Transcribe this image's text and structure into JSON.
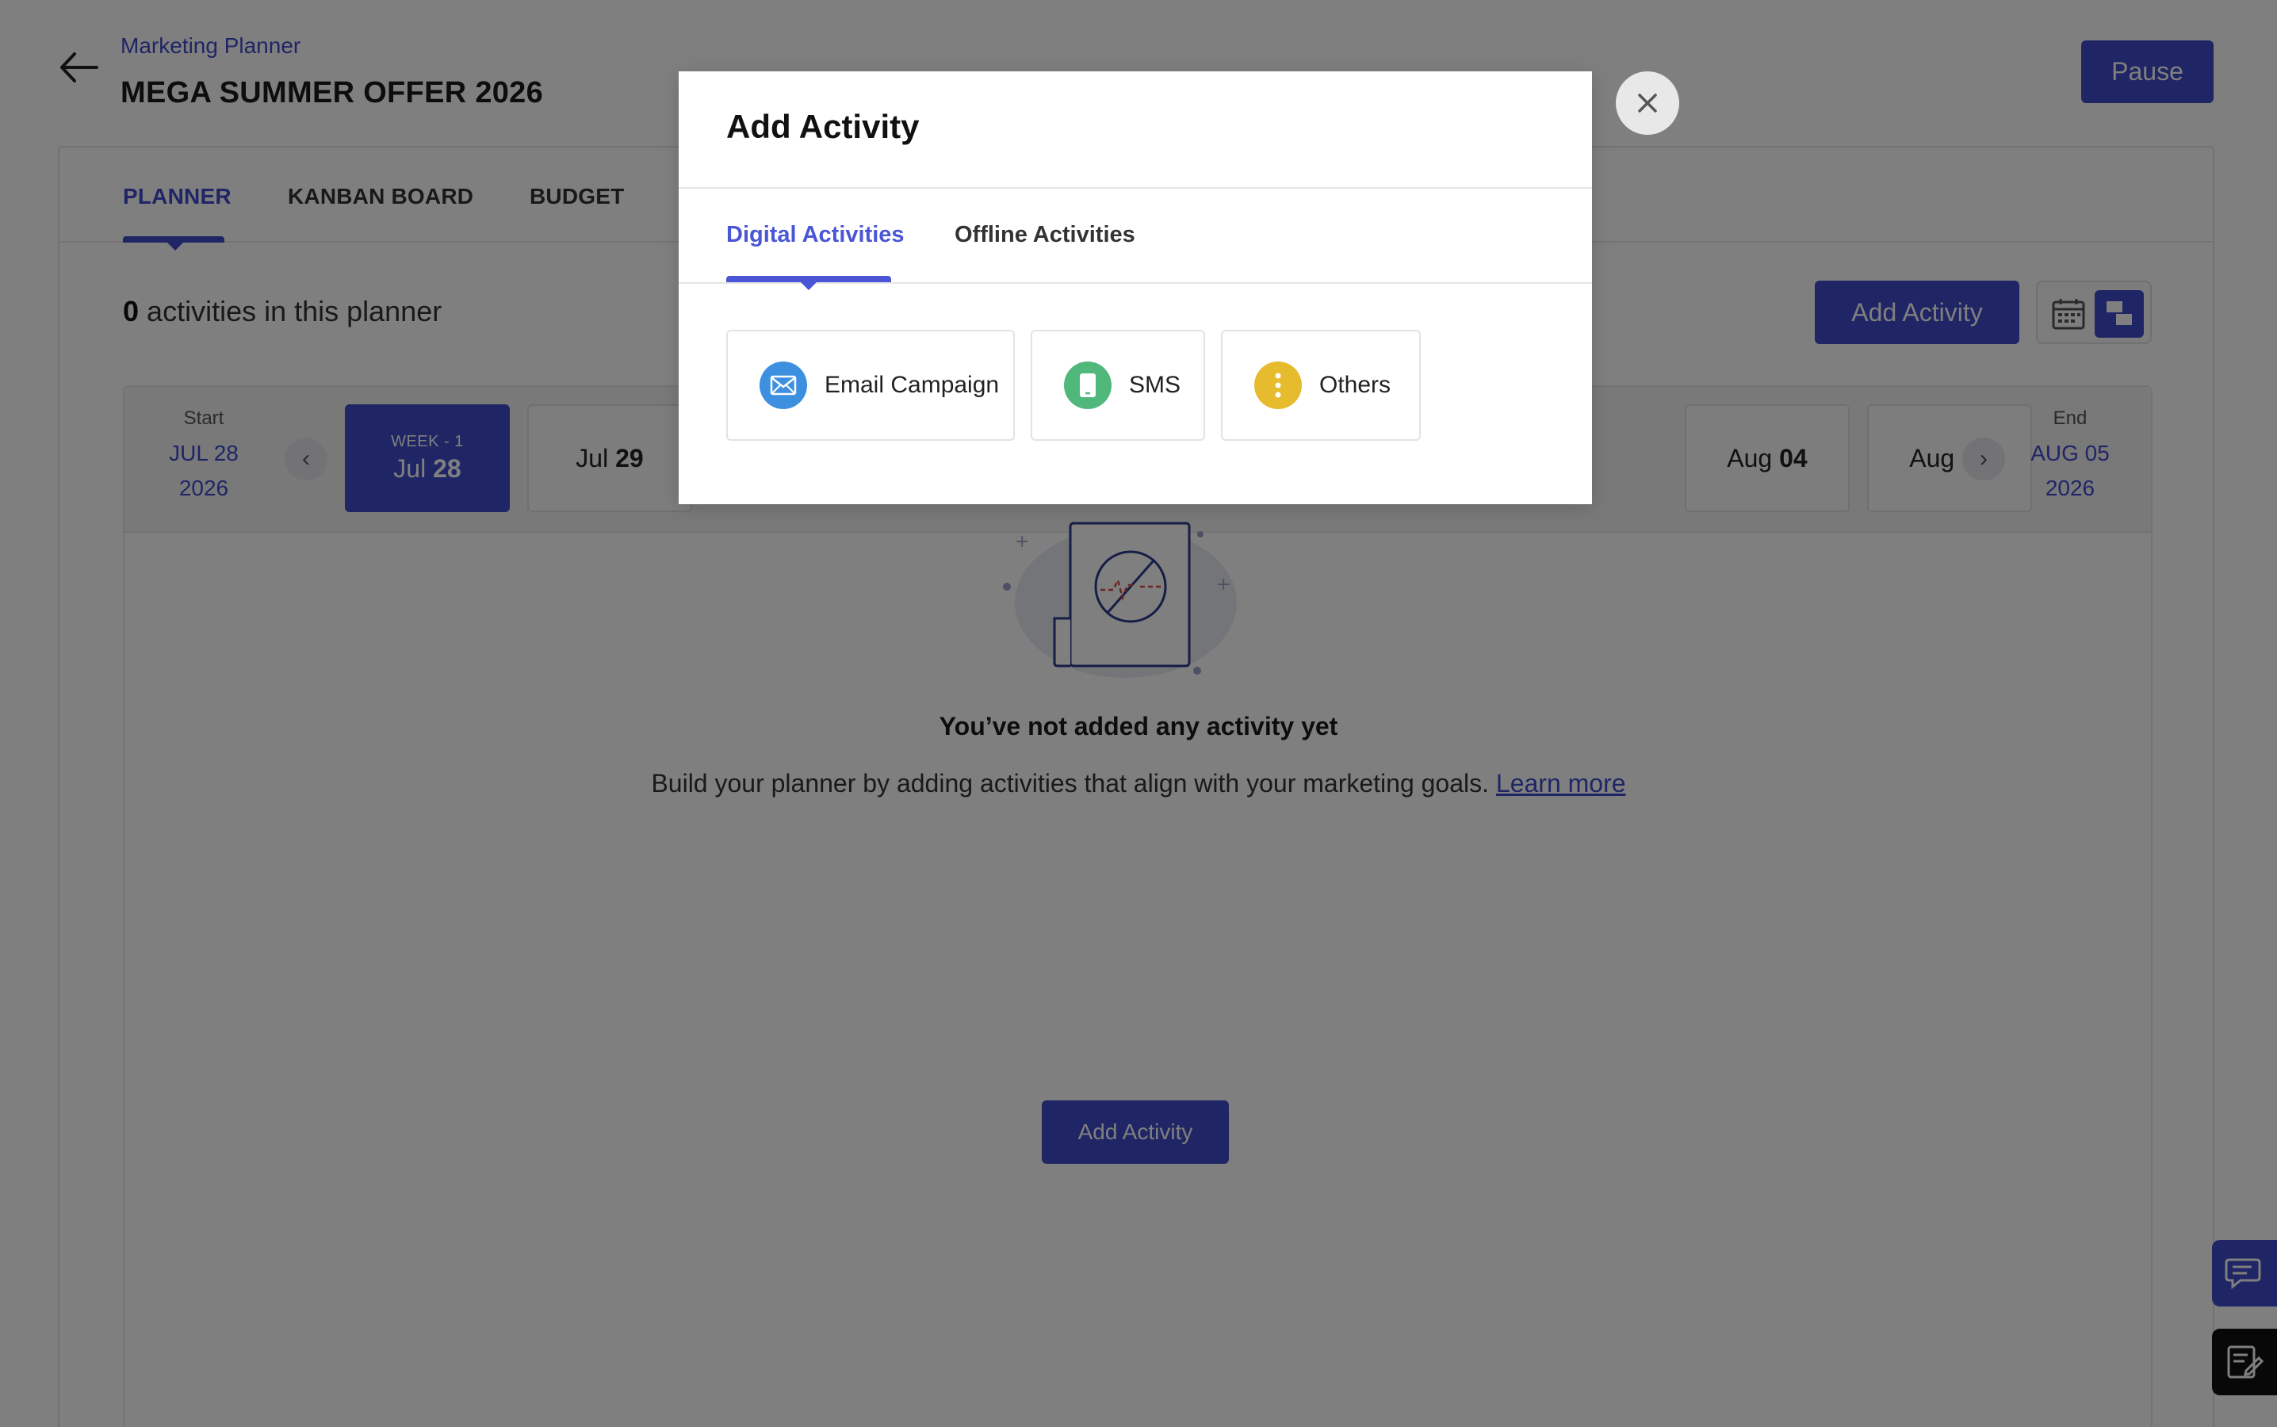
{
  "header": {
    "breadcrumb": "Marketing Planner",
    "title": "MEGA SUMMER OFFER 2026",
    "pause_label": "Pause"
  },
  "tabs": [
    "PLANNER",
    "KANBAN BOARD",
    "BUDGET"
  ],
  "summary": {
    "count": "0",
    "text": "activities in this planner"
  },
  "add_activity_label": "Add Activity",
  "timeline": {
    "start_label": "Start",
    "start_date_line1": "JUL 28",
    "start_date_line2": "2026",
    "end_label": "End",
    "end_date_line1": "AUG 05",
    "end_date_line2": "2026",
    "week_label": "WEEK - 1",
    "days": [
      {
        "month": "Jul",
        "day": "28"
      },
      {
        "month": "Jul",
        "day": "29"
      },
      {
        "month": "Aug",
        "day": "04"
      },
      {
        "month": "Aug",
        "day": "05"
      }
    ]
  },
  "empty_state": {
    "title": "You’ve not added any activity yet",
    "text": "Build your planner by adding activities that align with your marketing goals.",
    "link": "Learn more",
    "button": "Add Activity"
  },
  "modal": {
    "title": "Add Activity",
    "tabs": [
      "Digital Activities",
      "Offline Activities"
    ],
    "options": [
      {
        "label": "Email Campaign",
        "icon": "email-icon",
        "color": "#3d8fe0"
      },
      {
        "label": "SMS",
        "icon": "mobile-icon",
        "color": "#4fb87a"
      },
      {
        "label": "Others",
        "icon": "more-vertical-icon",
        "color": "#e6bb2e"
      }
    ]
  },
  "colors": {
    "accent": "#3f4bcb",
    "overlay": "rgba(0,0,0,0.5)"
  }
}
